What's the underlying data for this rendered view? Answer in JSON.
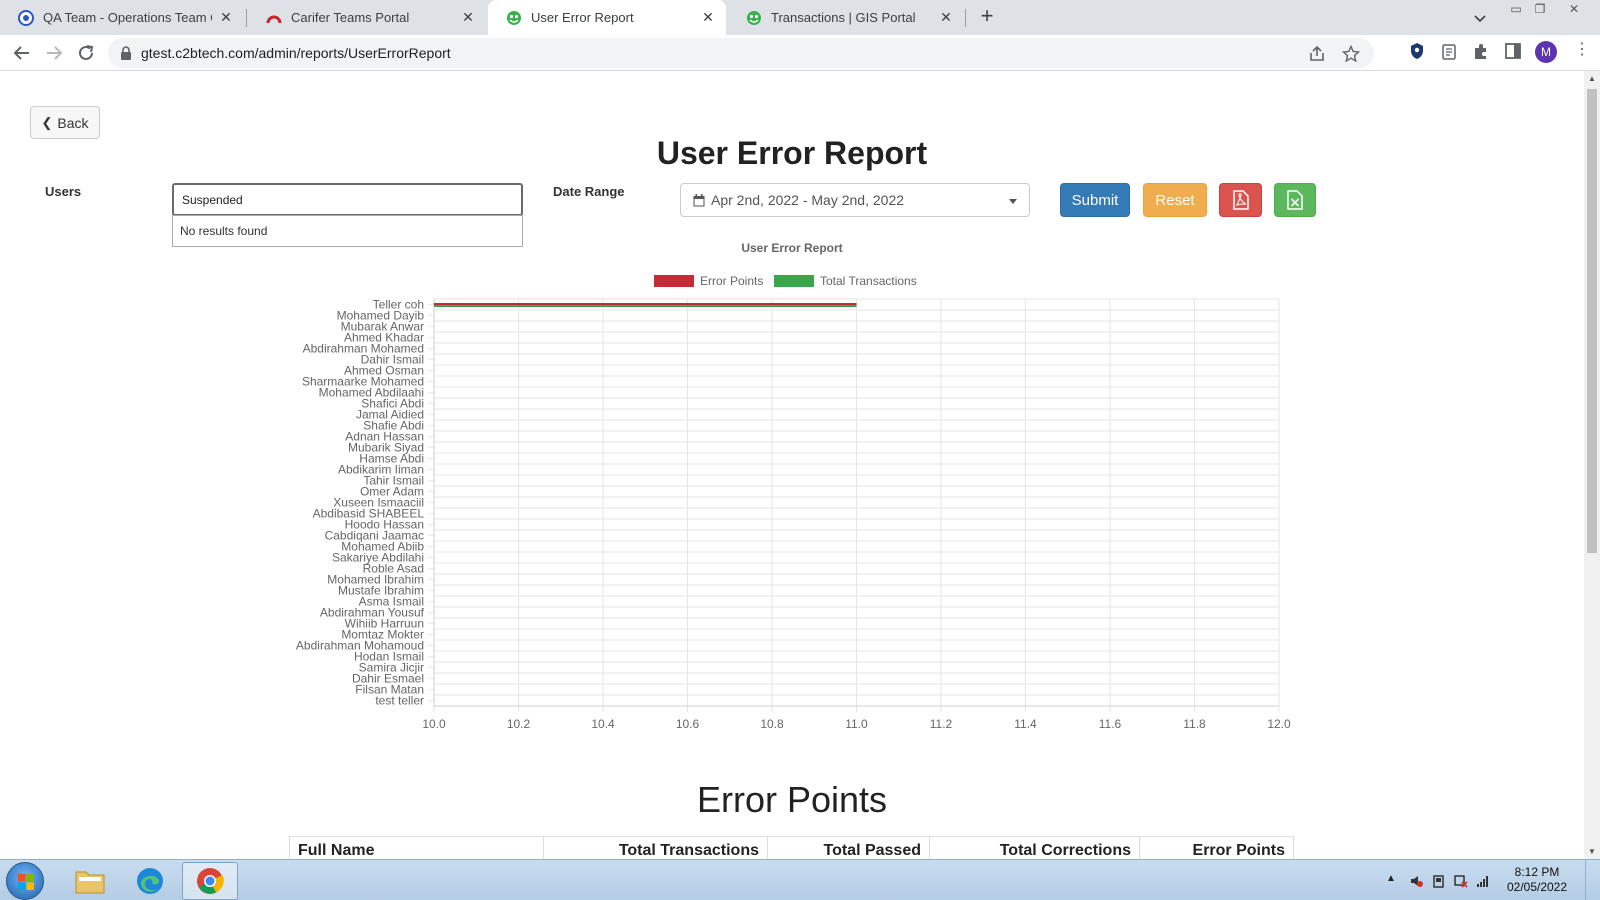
{
  "browser": {
    "tabs": [
      {
        "title": "QA Team - Operations Team Coll",
        "active": false
      },
      {
        "title": "Carifer Teams Portal",
        "active": false
      },
      {
        "title": "User Error Report",
        "active": true
      },
      {
        "title": "Transactions | GIS Portal",
        "active": false
      }
    ],
    "url": "gtest.c2btech.com/admin/reports/UserErrorReport",
    "profile_initial": "M"
  },
  "page": {
    "back_label": "Back",
    "title": "User Error Report",
    "users_label": "Users",
    "users_value": "Suspended",
    "dropdown_text": "No results found",
    "date_range_label": "Date Range",
    "date_range_value": "Apr 2nd, 2022 - May 2nd, 2022",
    "submit_label": "Submit",
    "reset_label": "Reset",
    "section_title": "Error Points",
    "table_headers": [
      "Full Name",
      "Total Transactions",
      "Total Passed",
      "Total Corrections",
      "Error Points"
    ]
  },
  "chart_data": {
    "type": "bar",
    "orientation": "horizontal",
    "title": "User Error Report",
    "categories": [
      "Teller coh",
      "Mohamed Dayib",
      "Mubarak Anwar",
      "Ahmed Khadar",
      "Abdirahman Mohamed",
      "Dahir Ismail",
      "Ahmed Osman",
      "Sharmaarke Mohamed",
      "Mohamed Abdilaahi",
      "Shafici Abdi",
      "Jamal Aidied",
      "Shafie Abdi",
      "Adnan Hassan",
      "Mubarik Siyad",
      "Hamse Abdi",
      "Abdikarim Iiman",
      "Tahir Ismail",
      "Omer Adam",
      "Xuseen Ismaaciil",
      "Abdibasid SHABEEL",
      "Hoodo Hassan",
      "Cabdiqani Jaamac",
      "Mohamed Abiib",
      "Sakariye Abdilahi",
      "Roble Asad",
      "Mohamed Ibrahim",
      "Mustafe Ibrahim",
      "Asma Ismail",
      "Abdirahman Yousuf",
      "Wihiib Harruun",
      "Momtaz Mokter",
      "Abdirahman Mohamoud",
      "Hodan Ismail",
      "Samira Jicjir",
      "Dahir Esmael",
      "Filsan Matan",
      "test teller"
    ],
    "series": [
      {
        "name": "Error Points",
        "color": "#c62a37",
        "values": [
          11,
          null,
          null,
          null,
          null,
          null,
          null,
          null,
          null,
          null,
          null,
          null,
          null,
          null,
          null,
          null,
          null,
          null,
          null,
          null,
          null,
          null,
          null,
          null,
          null,
          null,
          null,
          null,
          null,
          null,
          null,
          null,
          null,
          null,
          null,
          null,
          null
        ]
      },
      {
        "name": "Total Transactions",
        "color": "#3aa64a",
        "values": [
          11,
          null,
          null,
          null,
          null,
          null,
          null,
          null,
          null,
          null,
          null,
          null,
          null,
          null,
          null,
          null,
          null,
          null,
          null,
          null,
          null,
          null,
          null,
          null,
          null,
          null,
          null,
          null,
          null,
          null,
          null,
          null,
          null,
          null,
          null,
          null,
          null
        ]
      }
    ],
    "xlim": [
      10,
      12
    ],
    "xticks": [
      "10.0",
      "10.2",
      "10.4",
      "10.6",
      "10.8",
      "11.0",
      "11.2",
      "11.4",
      "11.6",
      "11.8",
      "12.0"
    ],
    "grid": true,
    "legend_position": "top"
  },
  "taskbar": {
    "time": "8:12 PM",
    "date": "02/05/2022"
  }
}
